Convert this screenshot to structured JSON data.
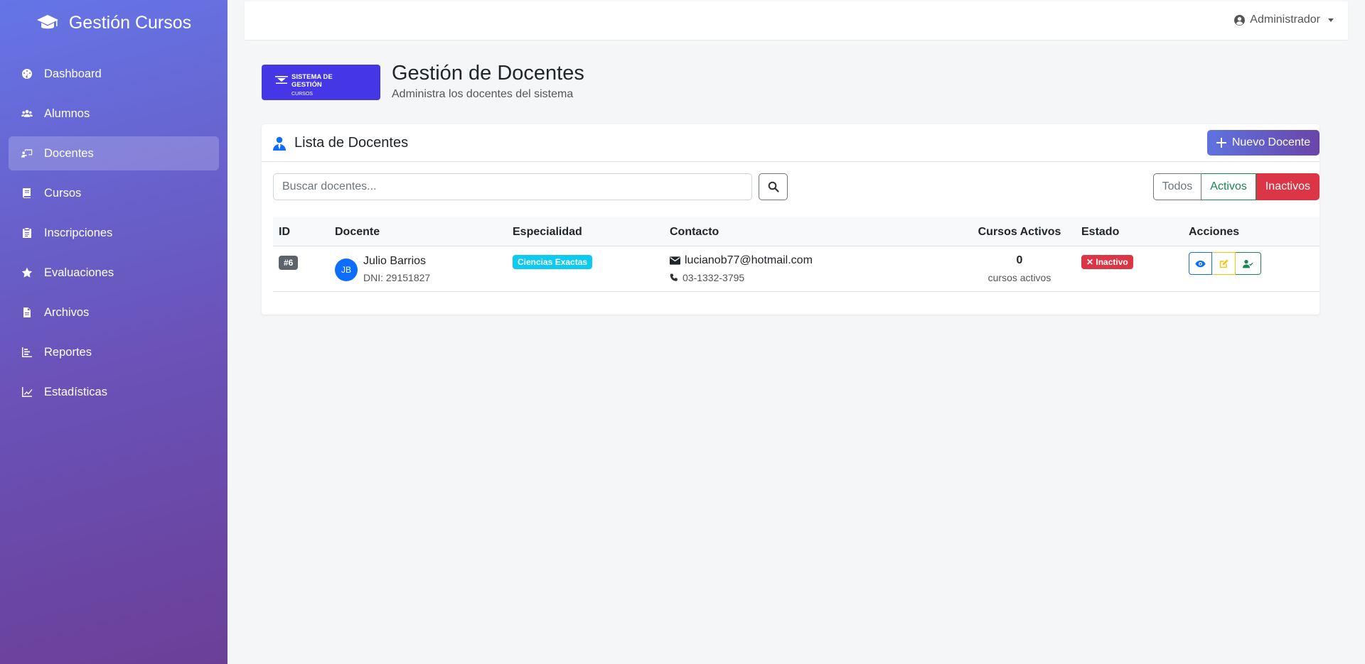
{
  "sidebar": {
    "brand": "Gestión Cursos",
    "brand_icon": "graduation-cap-icon",
    "items": [
      {
        "label": "Dashboard",
        "icon": "dashboard-icon",
        "active": false
      },
      {
        "label": "Alumnos",
        "icon": "users-icon",
        "active": false
      },
      {
        "label": "Docentes",
        "icon": "teacher-icon",
        "active": true
      },
      {
        "label": "Cursos",
        "icon": "book-icon",
        "active": false
      },
      {
        "label": "Inscripciones",
        "icon": "clipboard-icon",
        "active": false
      },
      {
        "label": "Evaluaciones",
        "icon": "star-icon",
        "active": false
      },
      {
        "label": "Archivos",
        "icon": "file-icon",
        "active": false
      },
      {
        "label": "Reportes",
        "icon": "bar-chart-icon",
        "active": false
      },
      {
        "label": "Estadísticas",
        "icon": "line-chart-icon",
        "active": false
      }
    ]
  },
  "topbar": {
    "user_label": "Administrador",
    "user_icon": "user-circle-icon"
  },
  "header": {
    "logo_line1": "SISTEMA DE",
    "logo_line2": "GESTIÓN",
    "logo_line3": "CURSOS",
    "title": "Gestión de Docentes",
    "subtitle": "Administra los docentes del sistema"
  },
  "card": {
    "title": "Lista de Docentes",
    "new_button": "Nuevo Docente",
    "search_placeholder": "Buscar docentes...",
    "search_value": "",
    "filters": {
      "todos": "Todos",
      "activos": "Activos",
      "inactivos": "Inactivos",
      "selected": "Inactivos"
    },
    "columns": {
      "id": "ID",
      "docente": "Docente",
      "especialidad": "Especialidad",
      "contacto": "Contacto",
      "cursos": "Cursos Activos",
      "estado": "Estado",
      "acciones": "Acciones"
    },
    "rows": [
      {
        "id": "#6",
        "initials": "JB",
        "name": "Julio Barrios",
        "dni": "DNI: 29151827",
        "especialidad": "Ciencias Exactas",
        "email": "lucianob77@hotmail.com",
        "phone": "03-1332-3795",
        "cursos_count": "0",
        "cursos_label": "cursos activos",
        "estado": "✕ Inactivo"
      }
    ]
  },
  "colors": {
    "sidebar_top": "#6575e6",
    "sidebar_bottom": "#6b3f98",
    "primary": "#0d6efd",
    "danger": "#dc3545",
    "success": "#198754",
    "warning": "#ffc107",
    "info": "#0dcaf0",
    "logo": "#4637e6"
  }
}
